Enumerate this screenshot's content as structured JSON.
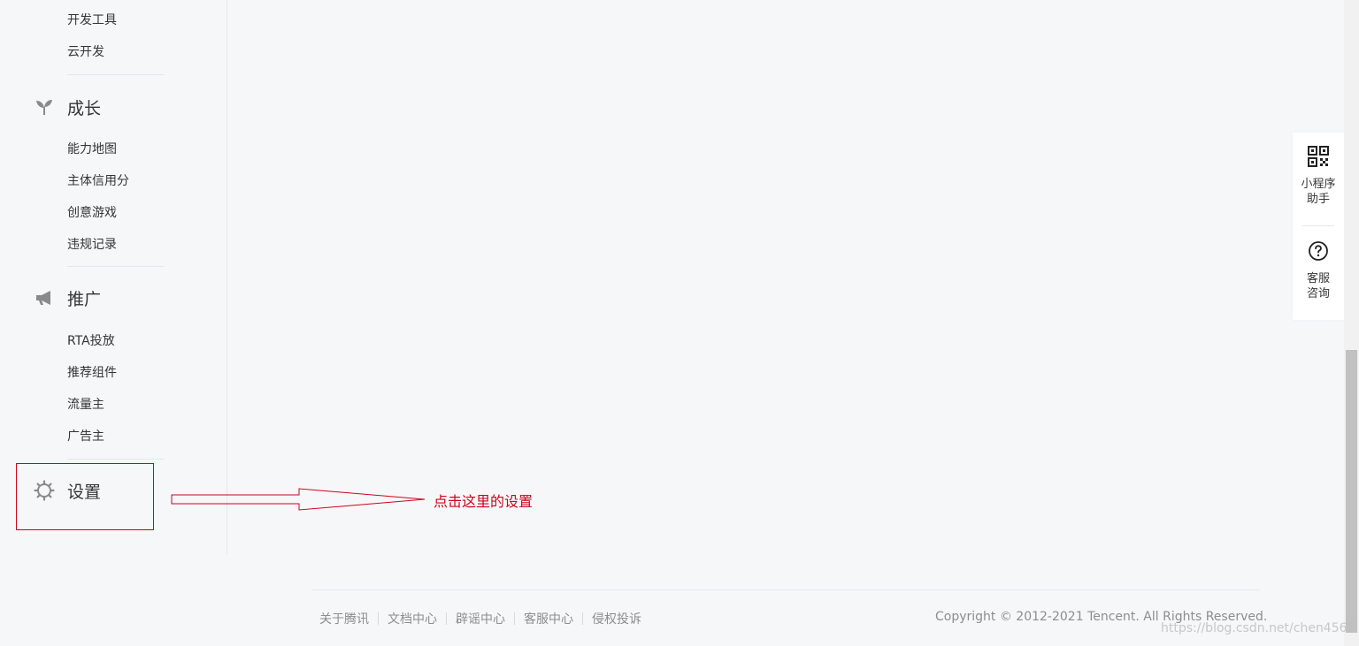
{
  "sidebar": {
    "dev_items": [
      "开发工具",
      "云开发"
    ],
    "growth": {
      "title": "成长",
      "icon": "sprout-icon",
      "items": [
        "能力地图",
        "主体信用分",
        "创意游戏",
        "违规记录"
      ]
    },
    "promotion": {
      "title": "推广",
      "icon": "megaphone-icon",
      "items": [
        "RTA投放",
        "推荐组件",
        "流量主",
        "广告主"
      ]
    },
    "settings": {
      "title": "设置",
      "icon": "gear-icon"
    }
  },
  "annotation": {
    "text": "点击这里的设置",
    "color": "#d0021b"
  },
  "float_panel": {
    "assistant": {
      "label_line1": "小程序",
      "label_line2": "助手",
      "icon": "qrcode-icon"
    },
    "consult": {
      "label_line1": "客服",
      "label_line2": "咨询",
      "icon": "question-circle-icon"
    }
  },
  "footer": {
    "links": [
      "关于腾讯",
      "文档中心",
      "辟谣中心",
      "客服中心",
      "侵权投诉"
    ],
    "copyright": "Copyright © 2012-2021 Tencent. All Rights Reserved."
  },
  "watermark": "https://blog.csdn.net/chen4565"
}
